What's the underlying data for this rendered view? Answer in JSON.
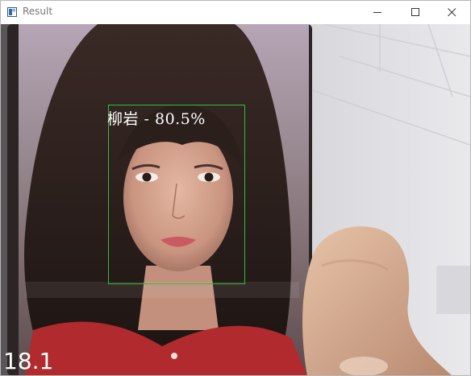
{
  "window": {
    "title": "Result",
    "icon": "opencv-window-icon",
    "controls": [
      "minimize-icon",
      "maximize-icon",
      "close-icon"
    ]
  },
  "detection": {
    "label": "柳岩 - 80.5%",
    "name": "柳岩",
    "confidence_percent": 80.5,
    "box_color": "#2fbf3c"
  },
  "overlay": {
    "fps": "18.1"
  }
}
